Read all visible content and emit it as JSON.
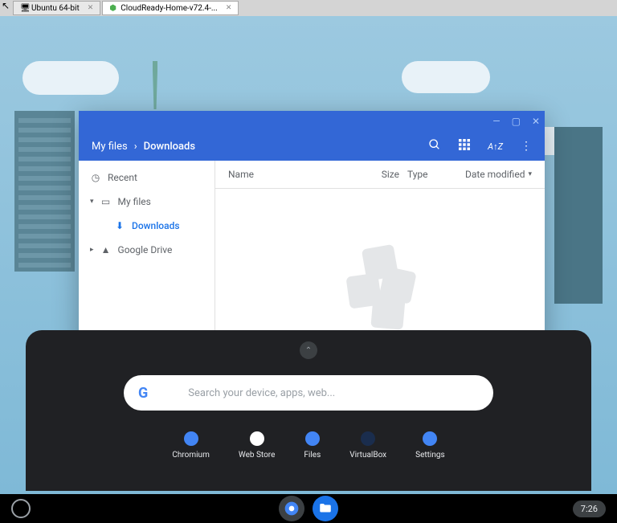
{
  "vm_tabs": {
    "tab1": "Ubuntu 64-bit",
    "tab2": "CloudReady-Home-v72.4-..."
  },
  "files_window": {
    "breadcrumb": {
      "root": "My files",
      "sep": "›",
      "current": "Downloads"
    },
    "sidebar": {
      "recent": "Recent",
      "myfiles": "My files",
      "downloads": "Downloads",
      "gdrive": "Google Drive"
    },
    "columns": {
      "name": "Name",
      "size": "Size",
      "type": "Type",
      "date": "Date modified"
    }
  },
  "launcher": {
    "search_placeholder": "Search your device, apps, web...",
    "apps": {
      "chromium": "Chromium",
      "webstore": "Web Store",
      "files": "Files",
      "virtualbox": "VirtualBox",
      "settings": "Settings"
    }
  },
  "shelf": {
    "time": "7:26"
  }
}
